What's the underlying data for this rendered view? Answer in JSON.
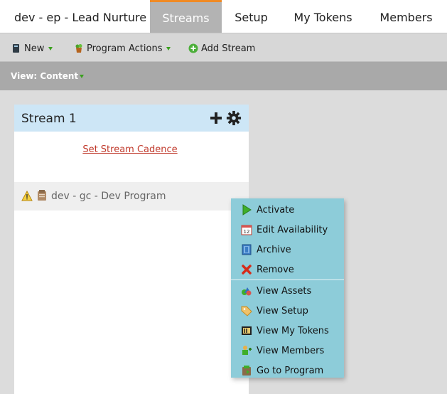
{
  "header": {
    "program_title": "dev - ep - Lead Nurture",
    "tabs": [
      {
        "label": "Streams",
        "active": true
      },
      {
        "label": "Setup",
        "active": false
      },
      {
        "label": "My Tokens",
        "active": false
      },
      {
        "label": "Members",
        "active": false
      }
    ]
  },
  "toolbar": {
    "new_label": "New",
    "program_actions_label": "Program Actions",
    "add_stream_label": "Add Stream"
  },
  "viewbar": {
    "view_label": "View: Content"
  },
  "stream": {
    "title": "Stream 1",
    "cadence_link": "Set Stream Cadence",
    "items": [
      {
        "label": "dev - gc - Dev Program",
        "icons": [
          "warning-icon",
          "program-icon"
        ]
      }
    ]
  },
  "context_menu": {
    "items": [
      {
        "label": "Activate",
        "icon": "play-icon"
      },
      {
        "label": "Edit Availability",
        "icon": "calendar-icon"
      },
      {
        "label": "Archive",
        "icon": "archive-icon"
      },
      {
        "label": "Remove",
        "icon": "remove-icon"
      },
      {
        "label": "View Assets",
        "icon": "assets-icon"
      },
      {
        "label": "View Setup",
        "icon": "setup-tag-icon"
      },
      {
        "label": "View My Tokens",
        "icon": "tokens-icon"
      },
      {
        "label": "View Members",
        "icon": "members-icon"
      },
      {
        "label": "Go to Program",
        "icon": "program-icon"
      }
    ]
  },
  "colors": {
    "active_tab_bg": "#b3b3b3",
    "active_tab_accent": "#f08a24",
    "stream_header_bg": "#cde6f6",
    "link_red": "#c0392b",
    "menu_bg": "#8dccd9"
  }
}
